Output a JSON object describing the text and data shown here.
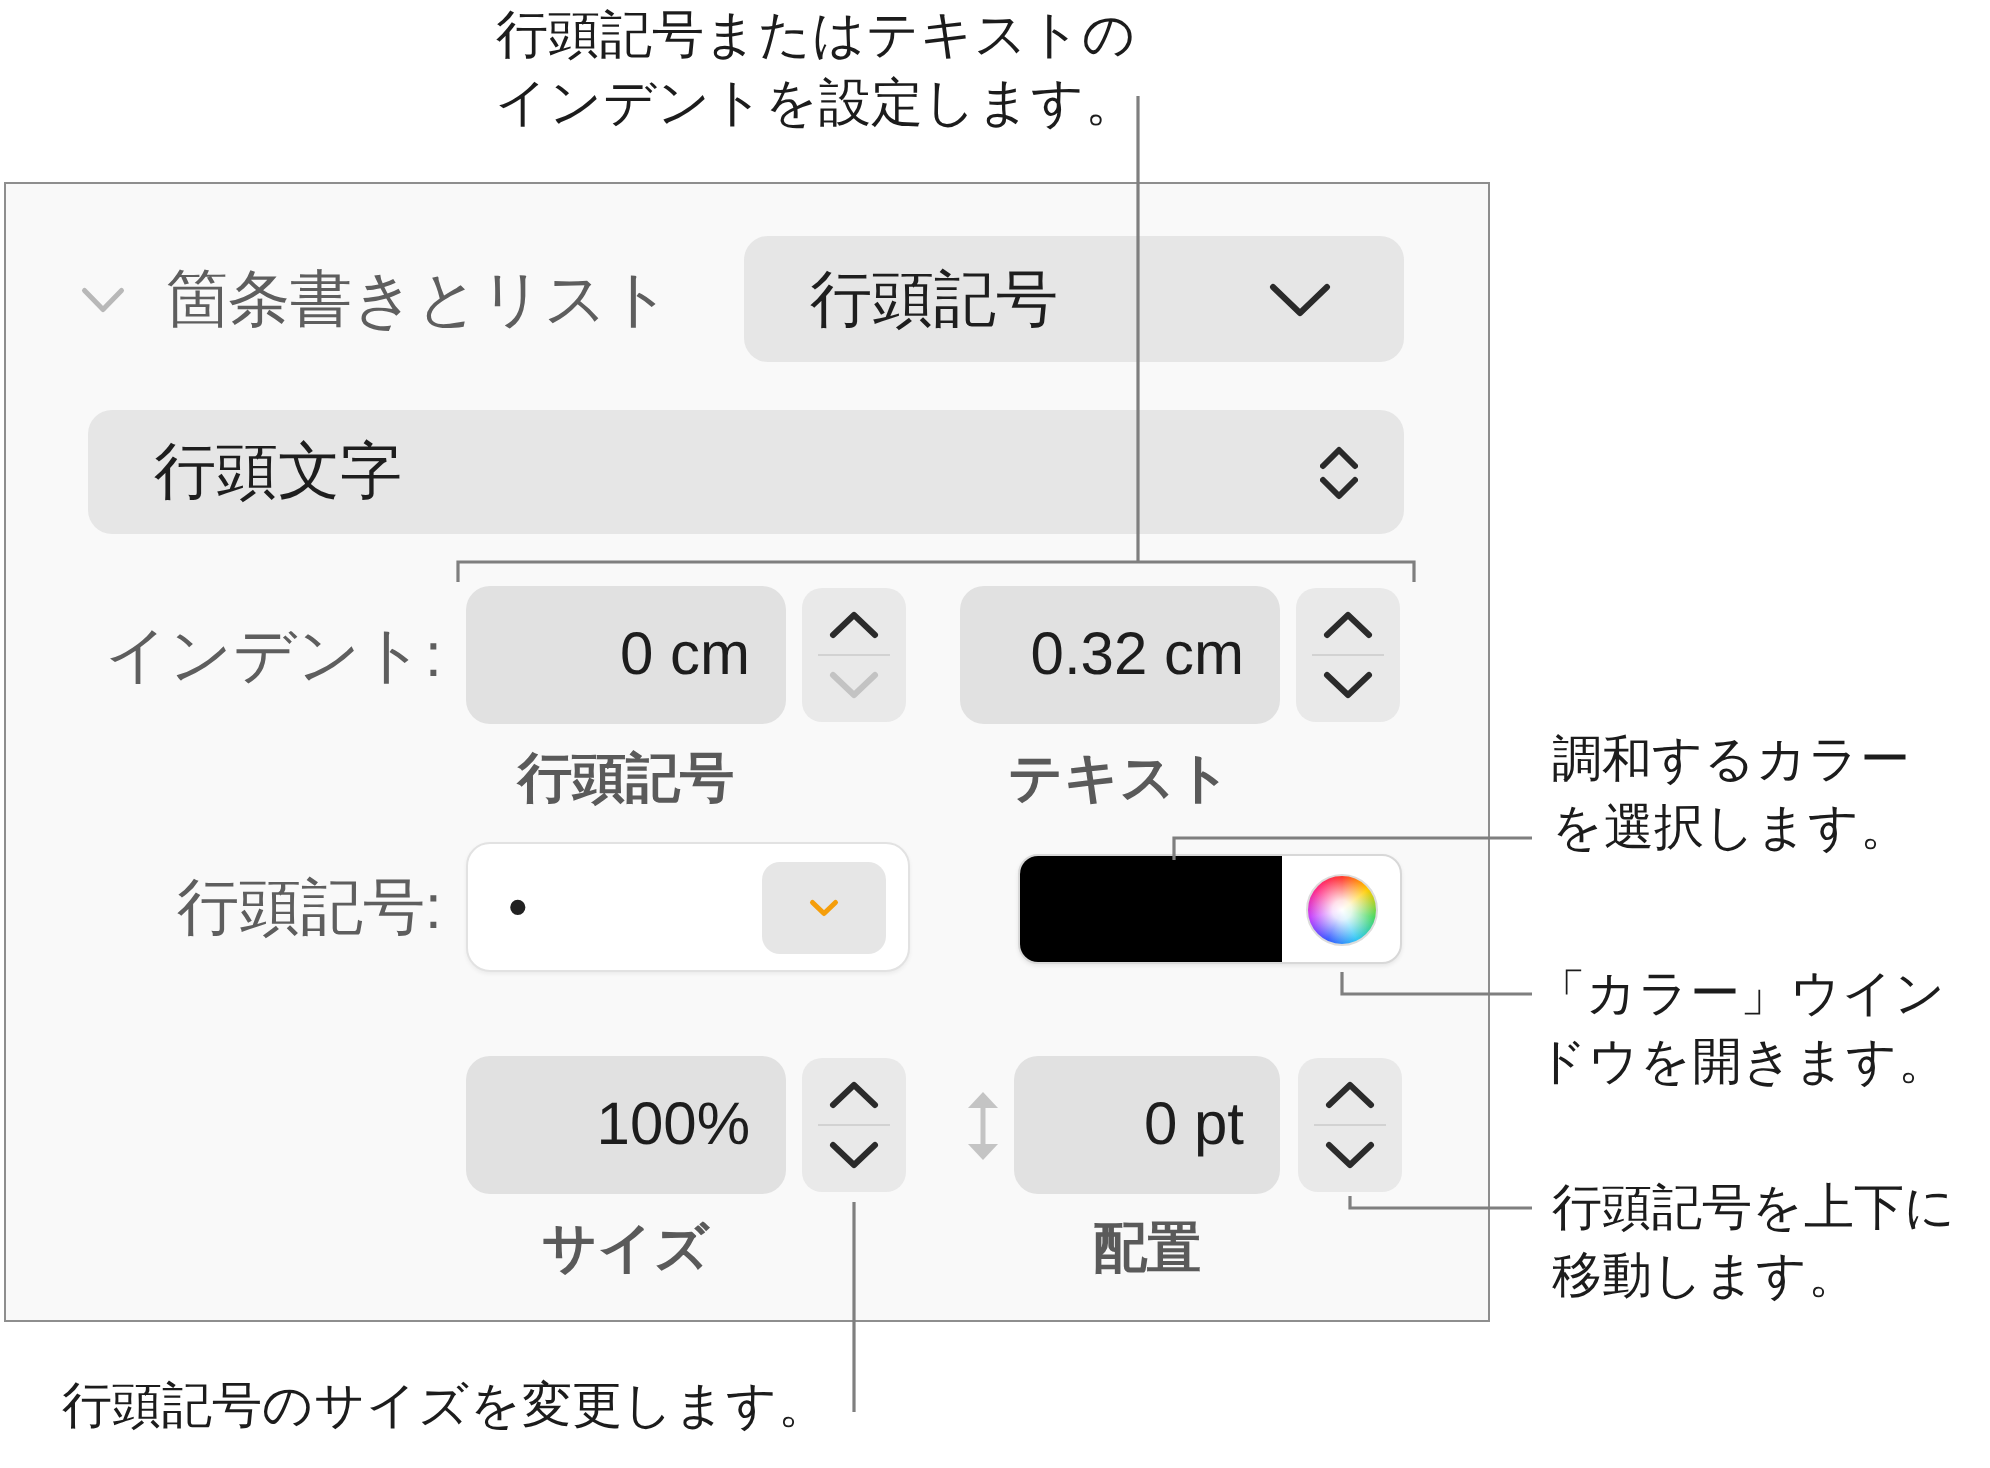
{
  "panel": {
    "section": {
      "title": "箇条書きとリスト",
      "expanded": true,
      "popup": "行頭記号"
    },
    "style_popup": "行頭文字",
    "indent": {
      "label": "インデント:",
      "fields": [
        {
          "value": "0 cm",
          "caption": "行頭記号",
          "up_disabled": false,
          "down_disabled": true
        },
        {
          "value": "0.32 cm",
          "caption": "テキスト",
          "up_disabled": false,
          "down_disabled": false
        }
      ]
    },
    "bullet": {
      "label": "行頭記号:",
      "value": "•",
      "color": "#000000"
    },
    "size": {
      "value": "100%",
      "caption": "サイズ",
      "up_disabled": false,
      "down_disabled": false
    },
    "alignment": {
      "value": "0 pt",
      "caption": "配置",
      "up_disabled": false,
      "down_disabled": false
    }
  },
  "callouts": [
    {
      "lines": [
        "行頭記号またはテキストの",
        "インデントを設定します。"
      ]
    },
    {
      "lines": [
        "調和するカラー",
        "を選択します。"
      ]
    },
    {
      "lines": [
        "「カラー」ウイン",
        "ドウを開きます。"
      ]
    },
    {
      "lines": [
        "行頭記号を上下に",
        "移動します。"
      ]
    },
    {
      "lines": [
        "行頭記号のサイズを変更します。"
      ]
    }
  ]
}
